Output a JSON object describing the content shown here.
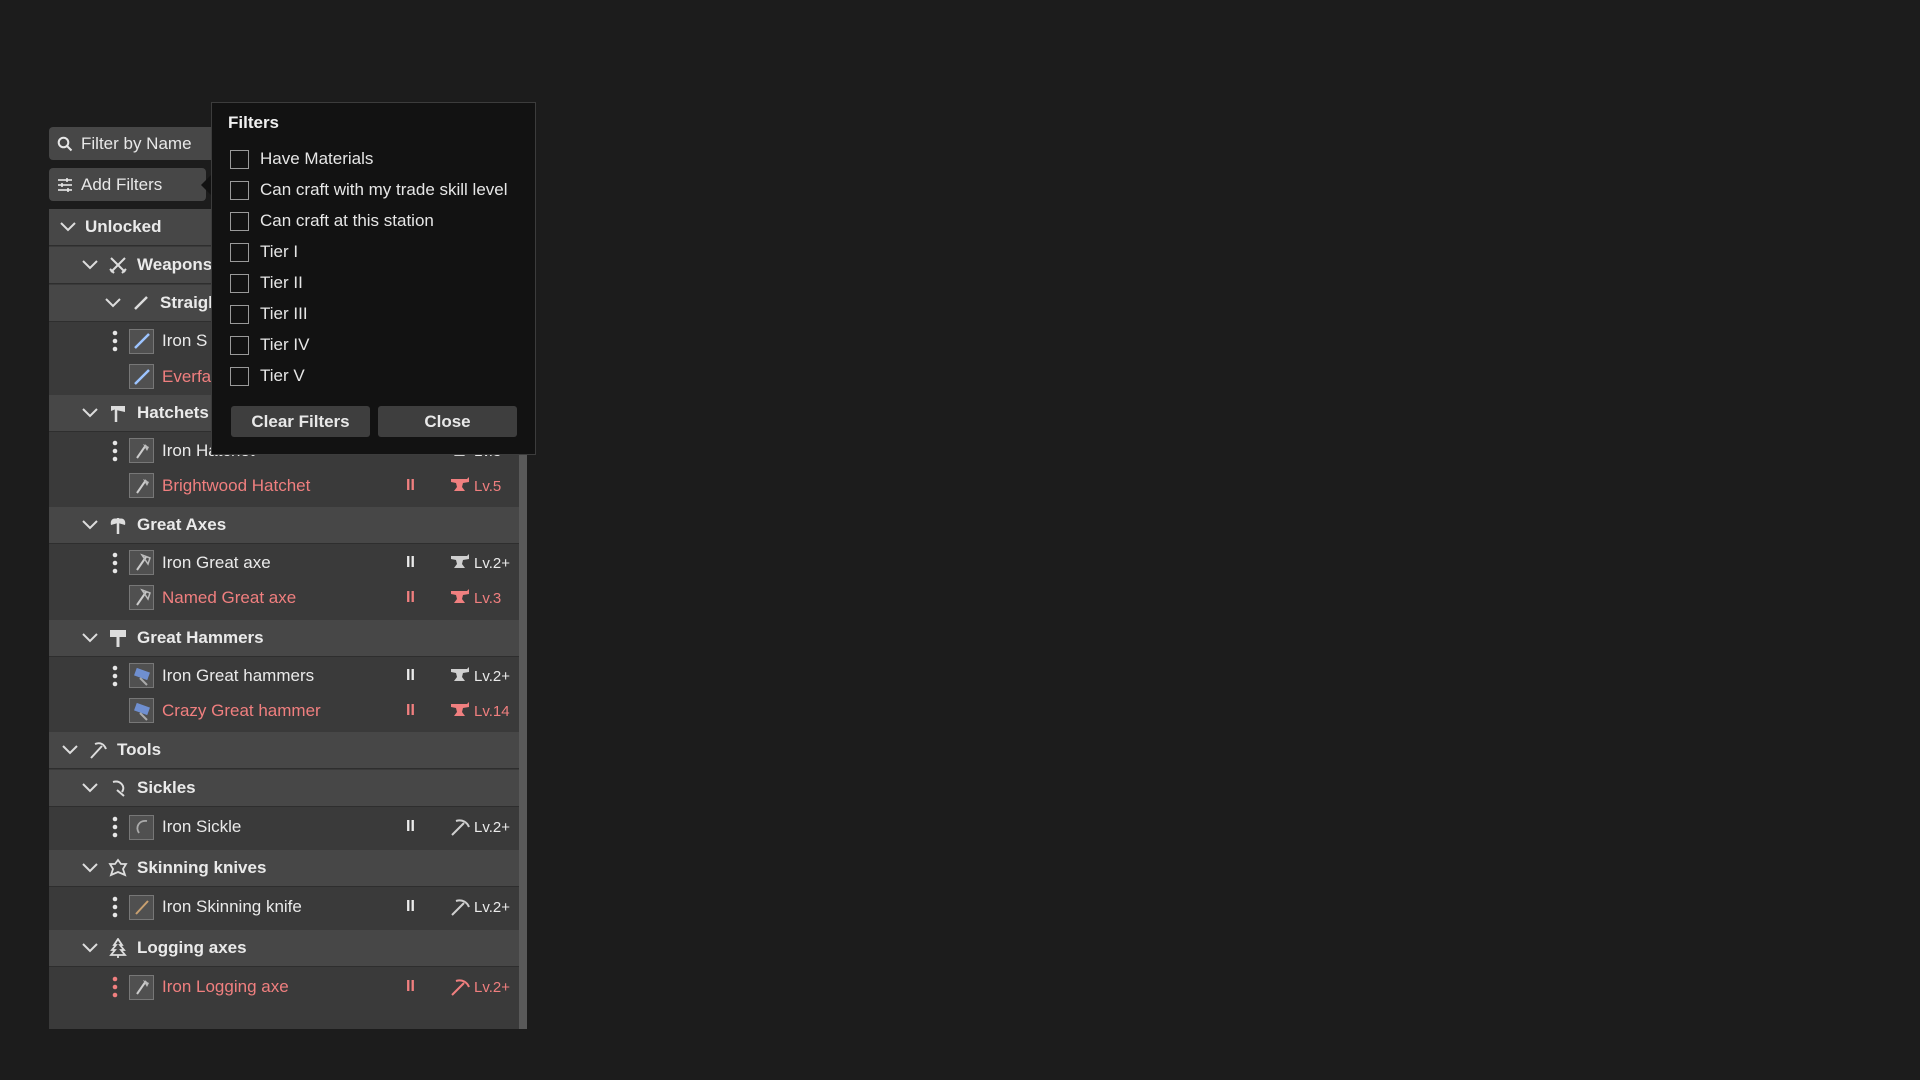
{
  "search": {
    "placeholder": "Filter by Name"
  },
  "add_filters": {
    "label": "Add Filters"
  },
  "colors": {
    "background": "#1c1c1c",
    "panel": "#3a3a3a",
    "header": "#474747",
    "unavailable": "#f07f7f"
  },
  "tree": {
    "unlocked": "Unlocked",
    "weapons": "Weapons",
    "straight_swords": "Straigh",
    "iron_sword": {
      "name": "Iron S"
    },
    "everfall_sword": {
      "name": "Everfa"
    },
    "hatchets": "Hatchets",
    "iron_hatchet": {
      "name": "Iron Hatchet",
      "tier": "II",
      "level": "Lv.3+"
    },
    "brightwood_hatchet": {
      "name": "Brightwood Hatchet",
      "tier": "II",
      "level": "Lv.5"
    },
    "great_axes": "Great Axes",
    "iron_great_axe": {
      "name": "Iron Great axe",
      "tier": "II",
      "level": "Lv.2+"
    },
    "named_great_axe": {
      "name": "Named Great axe",
      "tier": "II",
      "level": "Lv.3"
    },
    "great_hammers": "Great Hammers",
    "iron_great_hammers": {
      "name": "Iron Great hammers",
      "tier": "II",
      "level": "Lv.2+"
    },
    "crazy_great_hammer": {
      "name": "Crazy Great hammer",
      "tier": "II",
      "level": "Lv.14"
    },
    "tools": "Tools",
    "sickles": "Sickles",
    "iron_sickle": {
      "name": "Iron Sickle",
      "tier": "II",
      "level": "Lv.2+"
    },
    "skinning_knives": "Skinning knives",
    "iron_skinning_knife": {
      "name": "Iron Skinning knife",
      "tier": "II",
      "level": "Lv.2+"
    },
    "logging_axes": "Logging axes",
    "iron_logging_axe": {
      "name": "Iron Logging axe",
      "tier": "II",
      "level": "Lv.2+"
    }
  },
  "filters": {
    "title": "Filters",
    "options": [
      "Have Materials",
      "Can craft with my trade skill level",
      "Can craft at this station",
      "Tier I",
      "Tier II",
      "Tier III",
      "Tier IV",
      "Tier V"
    ],
    "clear_label": "Clear Filters",
    "close_label": "Close"
  }
}
